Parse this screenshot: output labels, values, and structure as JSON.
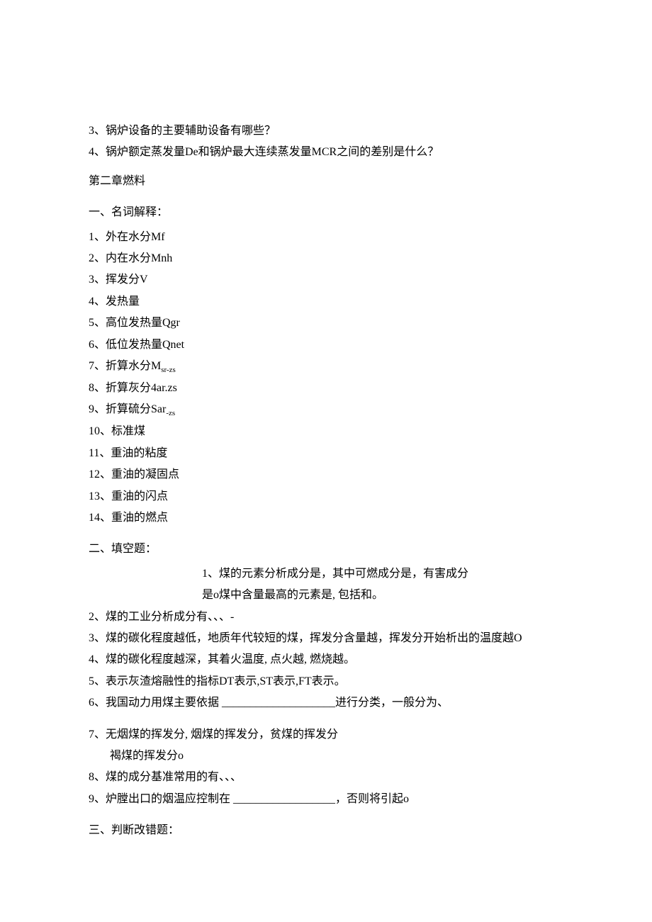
{
  "top_items": [
    "3、锅炉设备的主要辅助设备有哪些？",
    "4、锅炉额定蒸发量De和锅炉最大连续蒸发量MCR之间的差别是什么？"
  ],
  "chapter_title": "第二章燃料",
  "sec1_title": "一、名词解释：",
  "sec1_items_a": [
    "1、外在水分Mf",
    "2、内在水分Mnh",
    "3、挥发分V",
    "4、发热量",
    "5、高位发热量Qgr",
    "6、低位发热量Qnet"
  ],
  "sec1_item7_pre": "7、折算水分M",
  "sec1_item7_sub": "sr-zs",
  "sec1_item8": "8、折算灰分4ar.zs",
  "sec1_item9_pre": "9、折算硫分Sar",
  "sec1_item9_sub": "-zs",
  "sec1_items_b": [
    "10、标准煤",
    "11、重油的粘度",
    "12、重油的凝固点",
    "13、重油的闪点",
    "14、重油的燃点"
  ],
  "sec2_title": "二、填空题：",
  "sec2_center_a": "1、煤的元素分析成分是，其中可燃成分是，有害成分",
  "sec2_center_b": "是o煤中含量最高的元素是, 包括和。",
  "sec2_item2": "2、煤的工业分析成分有、、、-",
  "sec2_item3": "3、煤的碳化程度越低，地质年代较短的煤，挥发分含量越，挥发分开始析出的温度越O",
  "sec2_item4": "4、煤的碳化程度越深，其着火温度, 点火越, 燃烧越。",
  "sec2_item5": "5、表示灰渣熔融性的指标DT表示,ST表示,FT表示。",
  "sec2_item6_a": "6、我国动力用煤主要依据 ",
  "sec2_item6_blank": "____________________",
  "sec2_item6_b": "进行分类，一般分为、",
  "sec2_item7a": "7、无烟煤的挥发分, 烟煤的挥发分，贫煤的挥发分",
  "sec2_item7b": "褐煤的挥发分o",
  "sec2_item8": "8、煤的成分基准常用的有、、、",
  "sec2_item9_a": "9、炉膛出口的烟温应控制在 ",
  "sec2_item9_blank": "__________________",
  "sec2_item9_b": "，否则将引起o",
  "sec3_title": "三、判断改错题："
}
